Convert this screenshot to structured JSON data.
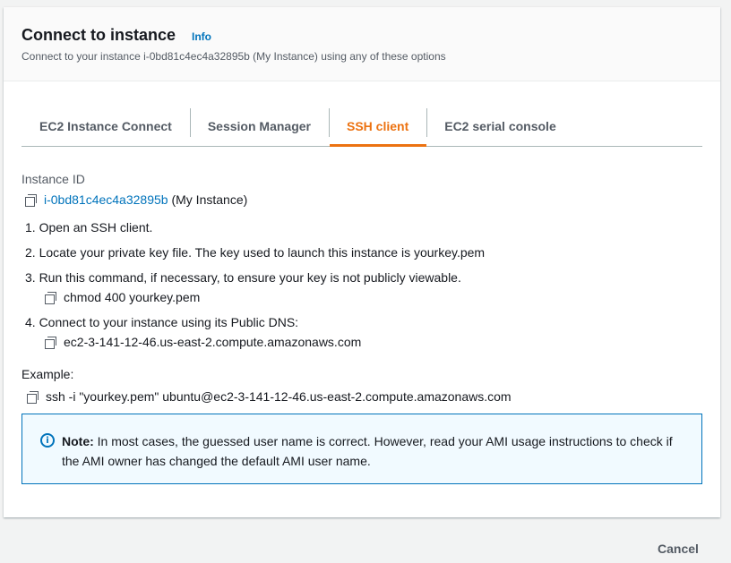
{
  "header": {
    "title": "Connect to instance",
    "info_label": "Info",
    "subtitle": "Connect to your instance i-0bd81c4ec4a32895b (My Instance) using any of these options"
  },
  "tabs": [
    {
      "label": "EC2 Instance Connect",
      "active": false
    },
    {
      "label": "Session Manager",
      "active": false
    },
    {
      "label": "SSH client",
      "active": true
    },
    {
      "label": "EC2 serial console",
      "active": false
    }
  ],
  "instance": {
    "label": "Instance ID",
    "id": "i-0bd81c4ec4a32895b",
    "name": " (My Instance)"
  },
  "steps": [
    "1. Open an SSH client.",
    "2. Locate your private key file. The key used to launch this instance is yourkey.pem",
    "3. Run this command, if necessary, to ensure your key is not publicly viewable.",
    "4. Connect to your instance using its Public DNS:"
  ],
  "commands": {
    "chmod": "chmod 400 yourkey.pem",
    "public_dns": "ec2-3-141-12-46.us-east-2.compute.amazonaws.com"
  },
  "example": {
    "label": "Example:",
    "command": "ssh -i \"yourkey.pem\" ubuntu@ec2-3-141-12-46.us-east-2.compute.amazonaws.com"
  },
  "note": {
    "icon": "info-icon",
    "bold": "Note:",
    "text": " In most cases, the guessed user name is correct. However, read your AMI usage instructions to check if the AMI owner has changed the default AMI user name."
  },
  "footer": {
    "cancel_label": "Cancel"
  },
  "colors": {
    "accent_orange": "#ec7211",
    "link_blue": "#0073bb",
    "note_bg": "#f1faff"
  }
}
